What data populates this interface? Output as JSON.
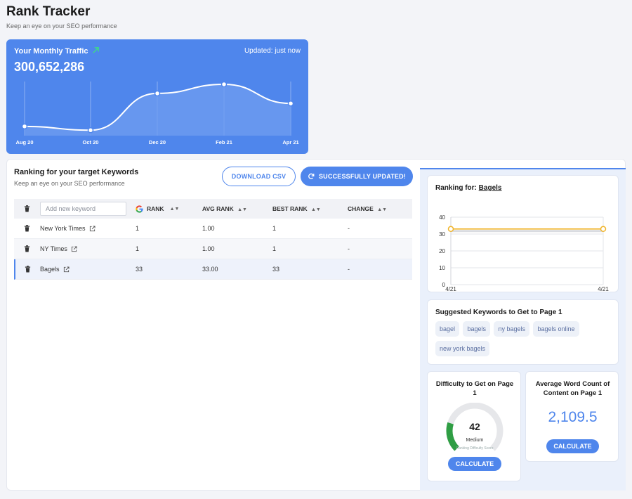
{
  "header": {
    "title": "Rank Tracker",
    "subtitle": "Keep an eye on your SEO performance"
  },
  "traffic": {
    "title": "Your Monthly Traffic",
    "updated": "Updated: just now",
    "value": "300,652,286",
    "accent": "#4f86ec",
    "arrow_color": "#3ddc84",
    "chart_data": {
      "type": "area",
      "x": [
        "Aug 20",
        "Oct 20",
        "Dec 20",
        "Feb 21",
        "Apr 21"
      ],
      "y_relative": [
        0.12,
        0.04,
        0.81,
        1.0,
        0.6
      ]
    }
  },
  "ranking": {
    "title": "Ranking for your target Keywords",
    "subtitle": "Keep an eye on your SEO performance",
    "download_label": "DOWNLOAD CSV",
    "updated_label": "SUCCESSFULLY UPDATED!",
    "input_placeholder": "Add new keyword",
    "columns": {
      "rank": "RANK",
      "avg": "AVG RANK",
      "best": "BEST RANK",
      "change": "CHANGE"
    },
    "rows": [
      {
        "keyword": "New York Times",
        "rank": "1",
        "avg": "1.00",
        "best": "1",
        "change": "-"
      },
      {
        "keyword": "NY Times",
        "rank": "1",
        "avg": "1.00",
        "best": "1",
        "change": "-"
      },
      {
        "keyword": "Bagels",
        "rank": "33",
        "avg": "33.00",
        "best": "33",
        "change": "-"
      }
    ]
  },
  "ranking_for": {
    "label": "Ranking for:",
    "keyword": "Bagels",
    "chart_data": {
      "type": "line",
      "x": [
        "4/21",
        "4/21"
      ],
      "series": [
        {
          "values": [
            33,
            33
          ],
          "color": "#f0b429"
        }
      ],
      "ylim": [
        0,
        40
      ],
      "yticks": [
        "40",
        "30",
        "20",
        "10",
        "0"
      ]
    }
  },
  "suggested": {
    "title": "Suggested Keywords to Get to Page 1",
    "chips": [
      "bagel",
      "bagels",
      "ny bagels",
      "bagels online",
      "new york bagels"
    ]
  },
  "difficulty": {
    "title": "Difficulty to Get on Page 1",
    "value": "42",
    "level": "Medium",
    "caption": "Ranking Difficulty Score",
    "fraction": 0.42,
    "button": "CALCULATE"
  },
  "word_count": {
    "title": "Average Word Count of Content on Page 1",
    "value": "2,109.5",
    "button": "CALCULATE"
  }
}
